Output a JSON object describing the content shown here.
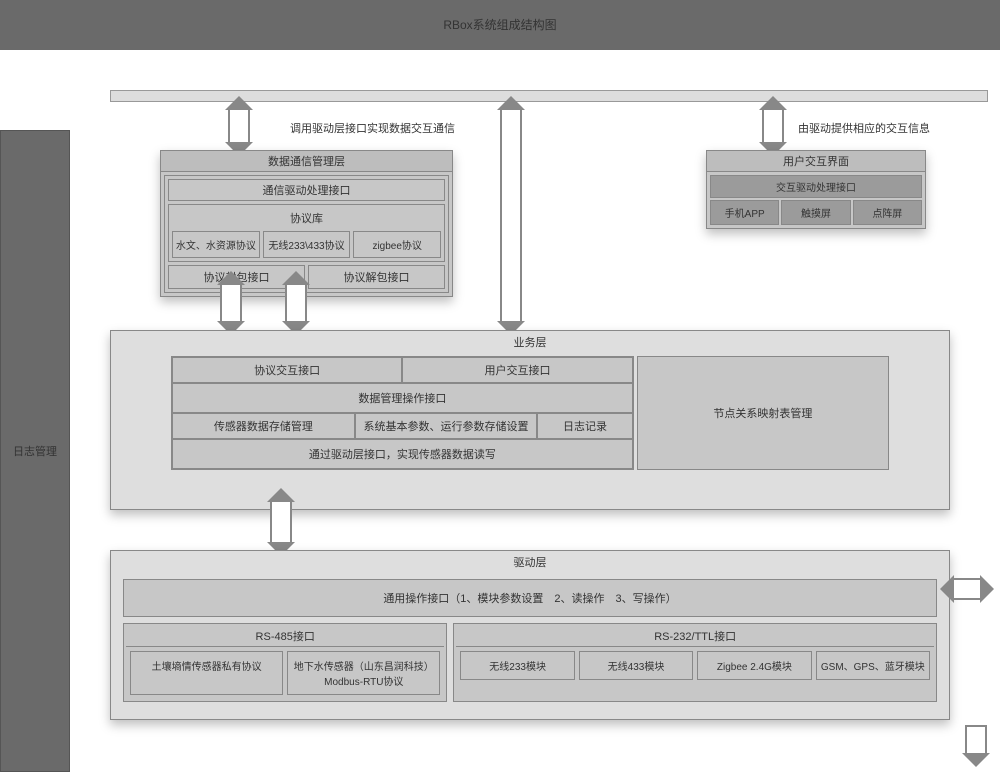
{
  "title": "RBox系统组成结构图",
  "sidebar_label": "日志管理",
  "captions": {
    "c1": "调用驱动层接口实现数据交互通信",
    "c2": "由驱动提供相应的交互信息"
  },
  "comm": {
    "header": "数据通信管理层",
    "driver_iface": "通信驱动处理接口",
    "proto_lib": "协议库",
    "protocols": [
      "水文、水资源协议",
      "无线233\\433协议",
      "zigbee协议"
    ],
    "pack": "协议封包接口",
    "unpack": "协议解包接口"
  },
  "ui": {
    "header": "用户交互界面",
    "driver_iface": "交互驱动处理接口",
    "items": [
      "手机APP",
      "触摸屏",
      "点阵屏"
    ]
  },
  "biz": {
    "header": "业务层",
    "proto_iface": "协议交互接口",
    "user_iface": "用户交互接口",
    "data_mgmt": "数据管理操作接口",
    "sensor_store": "传感器数据存储管理",
    "sys_params": "系统基本参数、运行参数存储设置",
    "log_record": "日志记录",
    "bottom_note": "通过驱动层接口，实现传感器数据读写",
    "node_map": "节点关系映射表管理"
  },
  "driver": {
    "header": "驱动层",
    "gen_iface": "通用操作接口（1、模块参数设置　2、读操作　3、写操作）",
    "rs485": {
      "title": "RS-485接口",
      "cells": [
        "土壤墒情传感器私有协议",
        "地下水传感器（山东昌润科技）Modbus-RTU协议"
      ]
    },
    "rs232": {
      "title": "RS-232/TTL接口",
      "cells": [
        "无线233模块",
        "无线433模块",
        "Zigbee 2.4G模块",
        "GSM、GPS、蓝牙模块"
      ]
    }
  }
}
